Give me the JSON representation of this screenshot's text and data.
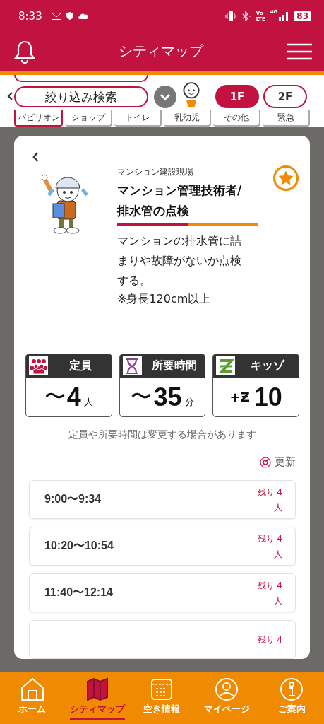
{
  "status_bar": {
    "time": "8:33",
    "volte": [
      "Vo",
      "LTE"
    ],
    "network": "4G",
    "battery": "83"
  },
  "header": {
    "title": "シティマップ"
  },
  "filter_bar": {
    "categories": [
      {
        "label": "パビリオン",
        "selected": true
      },
      {
        "label": "ショップ",
        "selected": false
      },
      {
        "label": "トイレ",
        "selected": false
      },
      {
        "label": "乳幼児",
        "selected": false
      },
      {
        "label": "その他",
        "selected": false
      },
      {
        "label": "緊急",
        "selected": false
      }
    ],
    "search_button": "絞り込み検索",
    "floors": [
      {
        "label": "1F",
        "selected": true
      },
      {
        "label": "2F",
        "selected": false
      }
    ]
  },
  "detail": {
    "category": "マンション建設現場",
    "title_lines": [
      "マンション管理技術者/",
      "排水管の点検"
    ],
    "favorite": true,
    "description": "マンションの排水管に詰まりや故障がないか点検する。",
    "note": "※身長120cm以上",
    "stats": [
      {
        "kind": "capacity",
        "label": "定員",
        "prefix": "〜",
        "value": "4",
        "unit": "人"
      },
      {
        "kind": "duration",
        "label": "所要時間",
        "prefix": "〜",
        "value": "35",
        "unit": "分"
      },
      {
        "kind": "kidzo",
        "label": "キッゾ",
        "prefix": "+Ƶ",
        "value": "10"
      }
    ],
    "notice": "定員や所要時間は変更する場合があります",
    "refresh": "更新",
    "slots": [
      {
        "time": "9:00〜9:34",
        "remaining": "残り 4人"
      },
      {
        "time": "10:20〜10:54",
        "remaining": "残り 4人"
      },
      {
        "time": "11:40〜12:14",
        "remaining": "残り 4人"
      },
      {
        "remaining": "残り 4"
      }
    ]
  },
  "bottom_nav": [
    {
      "kind": "home",
      "label": "ホーム",
      "selected": false
    },
    {
      "kind": "map",
      "label": "シティマップ",
      "selected": true
    },
    {
      "kind": "calendar",
      "label": "空き情報",
      "selected": false
    },
    {
      "kind": "person",
      "label": "マイページ",
      "selected": false
    },
    {
      "kind": "info",
      "label": "ご案内",
      "selected": false
    }
  ]
}
